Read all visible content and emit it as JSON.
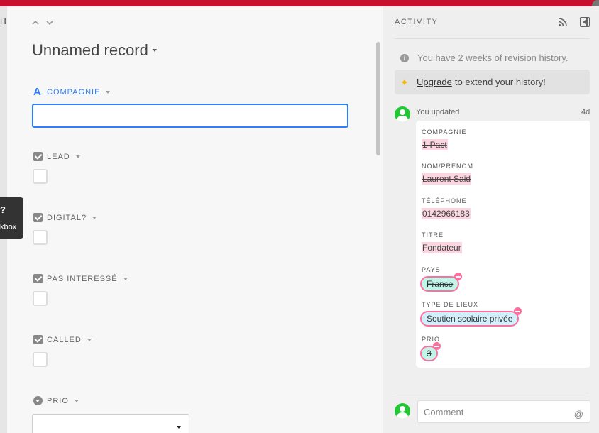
{
  "background": {
    "grid_header": "H",
    "tooltip": {
      "title": "?",
      "text": "kbox"
    }
  },
  "record": {
    "title": "Unnamed record",
    "fields": [
      {
        "label": "COMPAGNIE",
        "type": "text",
        "value": ""
      },
      {
        "label": "LEAD",
        "type": "checkbox",
        "checked": false
      },
      {
        "label": "DIGITAL?",
        "type": "checkbox",
        "checked": false
      },
      {
        "label": "PAS INTERESSÉ",
        "type": "checkbox",
        "checked": false
      },
      {
        "label": "CALLED",
        "type": "checkbox",
        "checked": false
      },
      {
        "label": "PRIO",
        "type": "select",
        "value": ""
      }
    ]
  },
  "activity": {
    "title": "ACTIVITY",
    "info": "You have 2 weeks of revision history.",
    "upgrade_link": "Upgrade",
    "upgrade_text": "to extend your history!",
    "update": {
      "author_text": "You updated",
      "time": "4d",
      "changes": [
        {
          "label": "COMPAGNIE",
          "old": "1-Pact"
        },
        {
          "label": "NOM/PRÉNOM",
          "old": "Laurent Said"
        },
        {
          "label": "TÉLÉPHONE",
          "old": "0142966183"
        },
        {
          "label": "TITRE",
          "old": "Fondateur"
        },
        {
          "label": "PAYS",
          "old": "France"
        },
        {
          "label": "TYPE DE LIEUX",
          "old": "Soutien scolaire privée"
        },
        {
          "label": "PRIO",
          "old": "3"
        }
      ]
    },
    "comment_placeholder": "Comment",
    "mention_symbol": "@"
  },
  "colors": {
    "accent": "#2d7ff9",
    "avatar": "#20c933",
    "removed": "#fbd5e0",
    "pill_border": "#ff6f9e"
  }
}
